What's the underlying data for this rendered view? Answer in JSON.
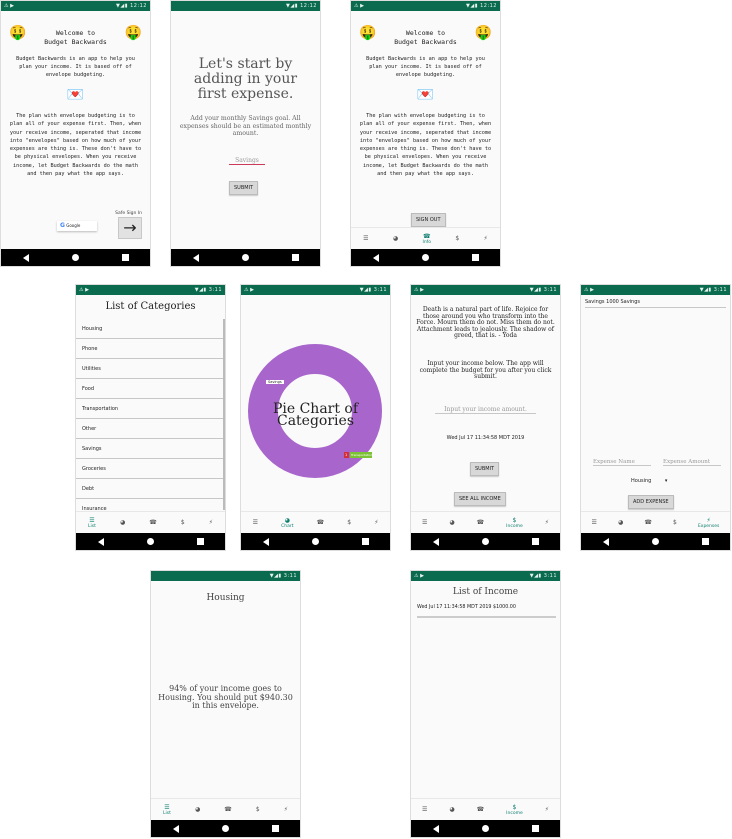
{
  "status": {
    "left_icons": "⚠ ▶",
    "time_a": "12:12",
    "time_b": "3:11",
    "icons": "▼◢▮"
  },
  "nav": {
    "back": "◀",
    "home": "●",
    "recent": "■"
  },
  "tabs": {
    "list": "List",
    "chart": "Chart",
    "info": "Info",
    "income": "Income",
    "expenses": "Expenses"
  },
  "welcome": {
    "title_line1": "Welcome to",
    "title_line2": "Budget Backwards",
    "intro": "Budget Backwards is an app to help you plan your income. It is based off of envelope budgeting.",
    "envelope_icon": "envelope-money-icon",
    "body": "The plan with envelope budgeting is to plan all of your expense first. Then, when your receive income, seperated that income into \"envelopes\" based on how much of your expenses are thing is. These don't have to be physical envelopes. When you receive income, let Budget Backwards do the math and then pay what the app says.",
    "signin_hint": "Safe Sign In",
    "google_label": "Google",
    "signout": "SIGN OUT"
  },
  "first_expense": {
    "heading": "Let's start by adding in your first expense.",
    "sub": "Add your monthly Savings goal. All expenses should be an estimated monthly amount.",
    "placeholder": "Savings",
    "submit": "SUBMIT"
  },
  "categories": {
    "title": "List of Categories",
    "items": [
      "Housing",
      "Phone",
      "Utilities",
      "Food",
      "Transportation",
      "Other",
      "Savings",
      "Groceries",
      "Debt",
      "Insurance"
    ]
  },
  "pie": {
    "title_line1": "Pie Chart of",
    "title_line2": "Categories",
    "savings_tag": "Savings",
    "small_a": "1",
    "small_b": "Transportation",
    "color_main": "#a866cc",
    "color_red": "#d0303a",
    "color_green": "#7cc235"
  },
  "income": {
    "quote": "Death is a natural part of life. Rejoice for those around you who transform into the Force. Mourn them do not. Miss them do not. Attachment leads to jealously. The shadow of greed, that is. - Yoda",
    "prompt": "Input your income below. The app will complete the budget for you after you click submit.",
    "placeholder": "Input your income amount.",
    "date": "Wed Jul 17 11:34:58 MDT 2019",
    "submit": "SUBMIT",
    "see_all": "SEE ALL INCOME"
  },
  "expenses": {
    "header_name": "Savings",
    "header_amount": "1000",
    "header_cat": "Savings",
    "name_placeholder": "Expense Name",
    "amount_placeholder": "Expense Amount",
    "category_value": "Housing",
    "add": "ADD EXPENSE"
  },
  "housing": {
    "title": "Housing",
    "message": "94% of your income goes to Housing. You should put $940.30 in this envelope."
  },
  "income_list": {
    "title": "List of Income",
    "row": "Wed Jul 17 11:34:58 MDT 2019 $1000.00"
  }
}
